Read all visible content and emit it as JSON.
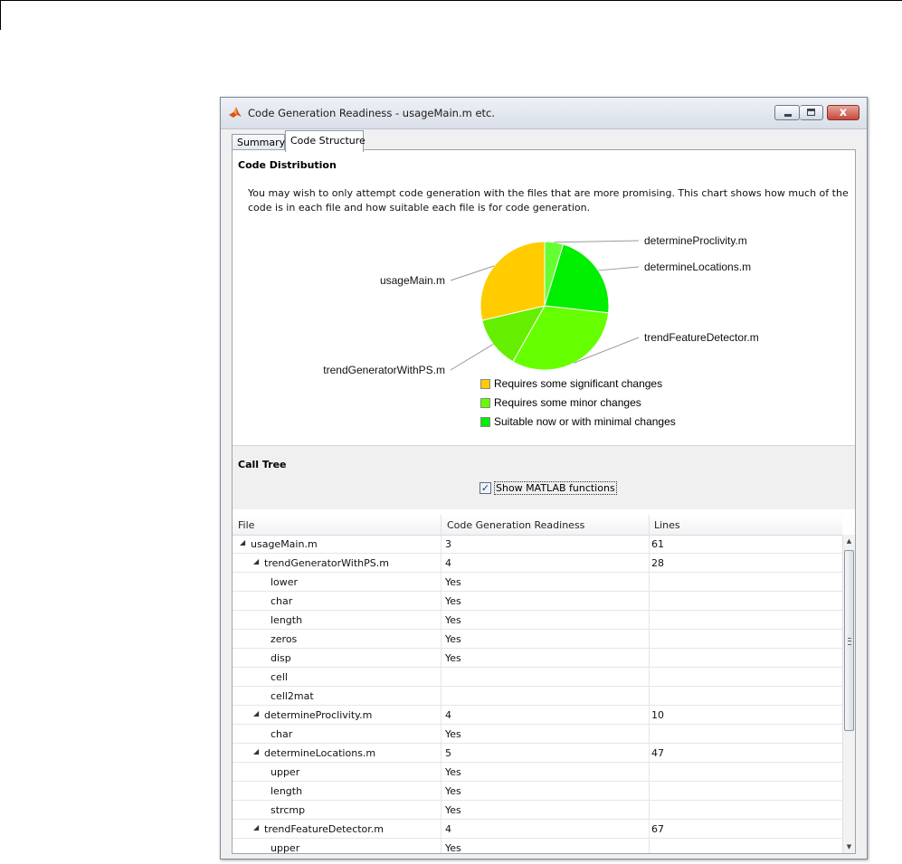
{
  "window": {
    "title": "Code Generation Readiness - usageMain.m etc.",
    "close_glyph": "x"
  },
  "tabs": [
    {
      "label": "Summary",
      "active": false
    },
    {
      "label": "Code Structure",
      "active": true
    }
  ],
  "code_distribution": {
    "heading": "Code Distribution",
    "description": "You may wish to only attempt code generation with the files that are more promising. This chart shows how much of the code is in each file and how suitable each file is for code generation."
  },
  "chart_data": {
    "type": "pie",
    "slices": [
      {
        "label": "determineProclivity.m",
        "value": 10,
        "status": "Suitable now or with minimal changes",
        "color": "#66ff33"
      },
      {
        "label": "determineLocations.m",
        "value": 47,
        "status": "Suitable now or with minimal changes",
        "color": "#00ee00"
      },
      {
        "label": "trendFeatureDetector.m",
        "value": 67,
        "status": "Requires some minor changes",
        "color": "#66ff00"
      },
      {
        "label": "trendGeneratorWithPS.m",
        "value": 28,
        "status": "Requires some minor changes",
        "color": "#66ee00"
      },
      {
        "label": "usageMain.m",
        "value": 61,
        "status": "Requires some significant changes",
        "color": "#ffcc00"
      }
    ],
    "legend": [
      {
        "label": "Requires some significant changes",
        "color": "#ffcc00"
      },
      {
        "label": "Requires some minor changes",
        "color": "#66ff00"
      },
      {
        "label": "Suitable now or with minimal changes",
        "color": "#00ee00"
      }
    ]
  },
  "call_tree": {
    "heading": "Call Tree",
    "show_matlab_label": "Show MATLAB functions",
    "show_matlab_checked": true,
    "checkmark": "✓",
    "columns": [
      "File",
      "Code Generation Readiness",
      "Lines"
    ],
    "rows": [
      {
        "depth": 0,
        "expander": "◢",
        "name": "usageMain.m",
        "readiness": "3",
        "lines": "61"
      },
      {
        "depth": 1,
        "expander": "◢",
        "name": "trendGeneratorWithPS.m",
        "readiness": "4",
        "lines": "28"
      },
      {
        "depth": 2,
        "expander": "",
        "name": "lower",
        "readiness": "Yes",
        "lines": ""
      },
      {
        "depth": 2,
        "expander": "",
        "name": "char",
        "readiness": "Yes",
        "lines": ""
      },
      {
        "depth": 2,
        "expander": "",
        "name": "length",
        "readiness": "Yes",
        "lines": ""
      },
      {
        "depth": 2,
        "expander": "",
        "name": "zeros",
        "readiness": "Yes",
        "lines": ""
      },
      {
        "depth": 2,
        "expander": "",
        "name": "disp",
        "readiness": "Yes",
        "lines": ""
      },
      {
        "depth": 2,
        "expander": "",
        "name": "cell",
        "readiness": "",
        "lines": ""
      },
      {
        "depth": 2,
        "expander": "",
        "name": "cell2mat",
        "readiness": "",
        "lines": ""
      },
      {
        "depth": 1,
        "expander": "◢",
        "name": "determineProclivity.m",
        "readiness": "4",
        "lines": "10"
      },
      {
        "depth": 2,
        "expander": "",
        "name": "char",
        "readiness": "Yes",
        "lines": ""
      },
      {
        "depth": 1,
        "expander": "◢",
        "name": "determineLocations.m",
        "readiness": "5",
        "lines": "47"
      },
      {
        "depth": 2,
        "expander": "",
        "name": "upper",
        "readiness": "Yes",
        "lines": ""
      },
      {
        "depth": 2,
        "expander": "",
        "name": "length",
        "readiness": "Yes",
        "lines": ""
      },
      {
        "depth": 2,
        "expander": "",
        "name": "strcmp",
        "readiness": "Yes",
        "lines": ""
      },
      {
        "depth": 1,
        "expander": "◢",
        "name": "trendFeatureDetector.m",
        "readiness": "4",
        "lines": "67"
      },
      {
        "depth": 2,
        "expander": "",
        "name": "upper",
        "readiness": "Yes",
        "lines": ""
      }
    ],
    "scroll_up": "▲",
    "scroll_down": "▼"
  }
}
